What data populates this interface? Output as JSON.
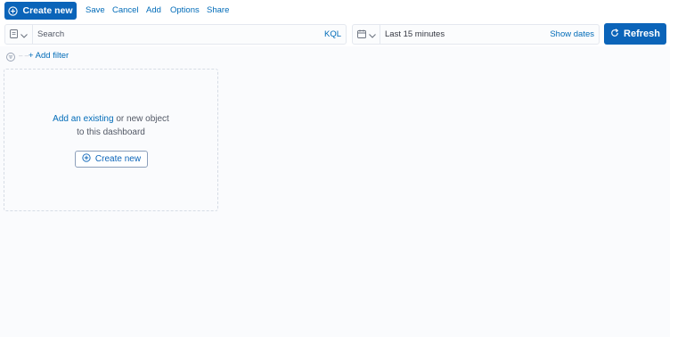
{
  "toolbar": {
    "create_new_label": "Create new",
    "menu": [
      "Save",
      "Cancel",
      "Add",
      "Options",
      "Share"
    ]
  },
  "query": {
    "search_placeholder": "Search",
    "language_label": "KQL",
    "date_range_label": "Last 15 minutes",
    "show_dates_label": "Show dates",
    "refresh_label": "Refresh"
  },
  "filters": {
    "add_filter_label": "+ Add filter"
  },
  "empty_panel": {
    "link_text": "Add an existing",
    "text_after_link": " or new object",
    "line2": "to this dashboard",
    "button_label": "Create new"
  },
  "icons": {
    "plus_in_circle": "plus-in-circle-icon",
    "save_query": "save-query-icon",
    "calendar": "calendar-icon",
    "refresh": "refresh-icon",
    "filter": "filter-icon"
  },
  "colors": {
    "primary": "#0b64b9",
    "link": "#006bb8",
    "canvas_bg": "#fafbfd"
  }
}
